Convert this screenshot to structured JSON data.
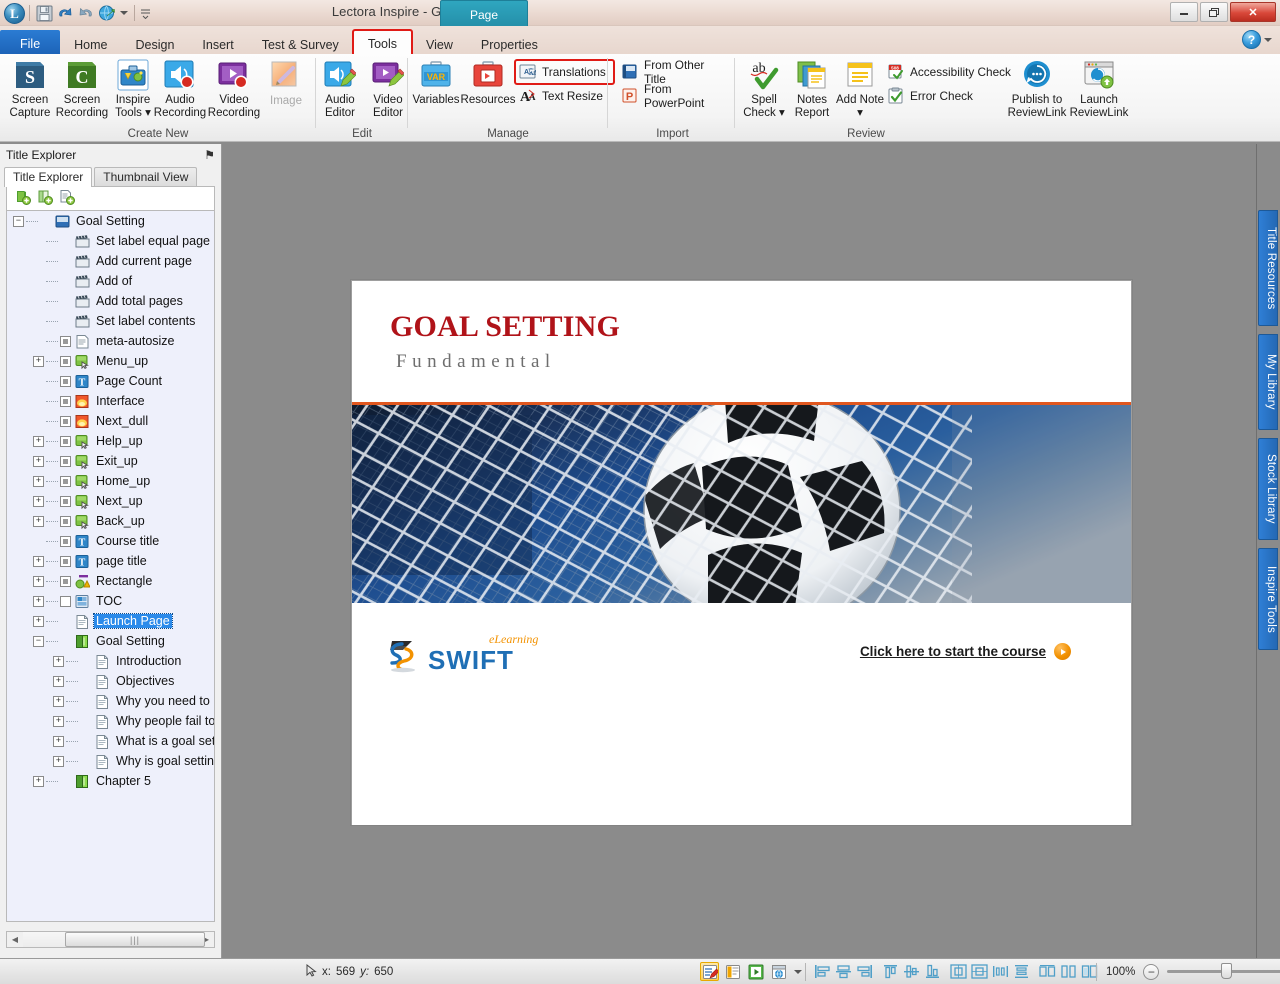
{
  "window": {
    "title": "Lectora Inspire - Goal Setting.awt",
    "minimize_label": "–",
    "restore_label": "❐",
    "close_label": "✕",
    "help_label": "?",
    "contextual_tab": "Page"
  },
  "quick_access": {
    "orb_label": "L",
    "items": [
      {
        "name": "save-icon",
        "label": "Save"
      },
      {
        "name": "undo-icon",
        "label": "Undo"
      },
      {
        "name": "redo-icon",
        "label": "Redo"
      },
      {
        "name": "preview-icon",
        "label": "Preview"
      },
      {
        "name": "customize-qat-icon",
        "label": "Customize Quick Access Toolbar"
      }
    ]
  },
  "ribbon": {
    "tabs": [
      {
        "label": "File",
        "active": false,
        "file": true
      },
      {
        "label": "Home",
        "active": false
      },
      {
        "label": "Design",
        "active": false
      },
      {
        "label": "Insert",
        "active": false
      },
      {
        "label": "Test & Survey",
        "active": false
      },
      {
        "label": "Tools",
        "active": true,
        "highlighted": true
      },
      {
        "label": "View",
        "active": false
      },
      {
        "label": "Properties",
        "active": false
      }
    ],
    "groups": {
      "create_new": {
        "label": "Create New",
        "buttons": [
          {
            "line1": "Screen",
            "line2": "Capture",
            "icon": "snagit-icon"
          },
          {
            "line1": "Screen",
            "line2": "Recording",
            "icon": "camtasia-icon"
          },
          {
            "line1": "Inspire",
            "line2": "Tools ▾",
            "icon": "inspire-tools-icon"
          },
          {
            "line1": "Audio",
            "line2": "Recording",
            "icon": "audio-record-icon"
          },
          {
            "line1": "Video",
            "line2": "Recording",
            "icon": "video-record-icon"
          },
          {
            "line1": "",
            "line2": "Image",
            "icon": "image-icon",
            "disabled": true
          }
        ]
      },
      "edit": {
        "label": "Edit",
        "buttons": [
          {
            "line1": "Audio",
            "line2": "Editor",
            "icon": "audio-editor-icon"
          },
          {
            "line1": "Video",
            "line2": "Editor",
            "icon": "video-editor-icon"
          }
        ]
      },
      "manage": {
        "label": "Manage",
        "buttons": [
          {
            "line1": "",
            "line2": "Variables",
            "icon": "variables-icon"
          },
          {
            "line1": "",
            "line2": "Resources",
            "icon": "resources-icon"
          }
        ],
        "small_buttons": [
          {
            "label": "Translations",
            "icon": "translations-icon",
            "highlighted": true
          },
          {
            "label": "Text Resize",
            "icon": "text-resize-icon",
            "highlighted": false
          }
        ]
      },
      "import": {
        "label": "Import",
        "small_buttons": [
          {
            "label": "From Other Title",
            "icon": "from-other-title-icon"
          },
          {
            "label": "From PowerPoint",
            "icon": "from-powerpoint-icon"
          }
        ]
      },
      "review": {
        "label": "Review",
        "buttons": [
          {
            "line1": "Spell",
            "line2": "Check ▾",
            "icon": "spell-check-icon"
          },
          {
            "line1": "Notes",
            "line2": "Report",
            "icon": "notes-report-icon"
          },
          {
            "line1": "Add Note",
            "line2": "▾",
            "icon": "add-note-icon"
          },
          {
            "line1": "Publish to",
            "line2": "ReviewLink",
            "icon": "publish-reviewlink-icon"
          },
          {
            "line1": "Launch",
            "line2": "ReviewLink",
            "icon": "launch-reviewlink-icon"
          }
        ],
        "small_buttons": [
          {
            "label": "Accessibility Check",
            "icon": "accessibility-check-icon"
          },
          {
            "label": "Error Check",
            "icon": "error-check-icon"
          }
        ]
      }
    }
  },
  "left_panel": {
    "header": "Title Explorer",
    "pin_glyph": "⚑",
    "tabs": [
      {
        "label": "Title Explorer",
        "active": true
      },
      {
        "label": "Thumbnail View",
        "active": false
      }
    ],
    "toolbar_icons": [
      {
        "name": "add-chapter-icon",
        "label": "Add Chapter"
      },
      {
        "name": "add-section-icon",
        "label": "Add Section"
      },
      {
        "name": "add-page-icon",
        "label": "Add Page"
      }
    ],
    "tree": [
      {
        "label": "Goal Setting",
        "indent": 0,
        "twist": "-",
        "check": "none",
        "icon": "title-book-icon"
      },
      {
        "label": "Set label equal page",
        "indent": 1,
        "twist": "",
        "check": "none",
        "icon": "action-icon"
      },
      {
        "label": "Add current page",
        "indent": 1,
        "twist": "",
        "check": "none",
        "icon": "action-icon"
      },
      {
        "label": "Add of",
        "indent": 1,
        "twist": "",
        "check": "none",
        "icon": "action-icon"
      },
      {
        "label": "Add total pages",
        "indent": 1,
        "twist": "",
        "check": "none",
        "icon": "action-icon"
      },
      {
        "label": "Set label contents",
        "indent": 1,
        "twist": "",
        "check": "none",
        "icon": "action-icon"
      },
      {
        "label": "meta-autosize",
        "indent": 1,
        "twist": "",
        "check": "filled",
        "icon": "text-block-icon"
      },
      {
        "label": "Menu_up",
        "indent": 1,
        "twist": "+",
        "check": "filled",
        "icon": "button-icon"
      },
      {
        "label": "Page Count",
        "indent": 1,
        "twist": "",
        "check": "filled",
        "icon": "text-icon"
      },
      {
        "label": "Interface",
        "indent": 1,
        "twist": "",
        "check": "filled",
        "icon": "image-thumb-icon"
      },
      {
        "label": "Next_dull",
        "indent": 1,
        "twist": "",
        "check": "filled",
        "icon": "image-thumb-icon"
      },
      {
        "label": "Help_up",
        "indent": 1,
        "twist": "+",
        "check": "filled",
        "icon": "button-icon"
      },
      {
        "label": "Exit_up",
        "indent": 1,
        "twist": "+",
        "check": "filled",
        "icon": "button-icon"
      },
      {
        "label": "Home_up",
        "indent": 1,
        "twist": "+",
        "check": "filled",
        "icon": "button-icon"
      },
      {
        "label": "Next_up",
        "indent": 1,
        "twist": "+",
        "check": "filled",
        "icon": "button-icon"
      },
      {
        "label": "Back_up",
        "indent": 1,
        "twist": "+",
        "check": "filled",
        "icon": "button-icon"
      },
      {
        "label": "Course title",
        "indent": 1,
        "twist": "",
        "check": "filled",
        "icon": "text-icon"
      },
      {
        "label": "page title",
        "indent": 1,
        "twist": "+",
        "check": "filled",
        "icon": "text-icon"
      },
      {
        "label": "Rectangle",
        "indent": 1,
        "twist": "+",
        "check": "filled",
        "icon": "shape-icon"
      },
      {
        "label": "TOC",
        "indent": 1,
        "twist": "+",
        "check": "empty",
        "icon": "toc-icon"
      },
      {
        "label": "Launch Page",
        "indent": 1,
        "twist": "+",
        "check": "none",
        "icon": "page-icon",
        "selected": true
      },
      {
        "label": "Goal Setting",
        "indent": 1,
        "twist": "-",
        "check": "none",
        "icon": "chapter-icon"
      },
      {
        "label": "Introduction",
        "indent": 2,
        "twist": "+",
        "check": "none",
        "icon": "page-icon"
      },
      {
        "label": "Objectives",
        "indent": 2,
        "twist": "+",
        "check": "none",
        "icon": "page-icon"
      },
      {
        "label": "Why you need to ha",
        "indent": 2,
        "twist": "+",
        "check": "none",
        "icon": "page-icon"
      },
      {
        "label": "Why people fail to a",
        "indent": 2,
        "twist": "+",
        "check": "none",
        "icon": "page-icon"
      },
      {
        "label": "What is a goal settin",
        "indent": 2,
        "twist": "+",
        "check": "none",
        "icon": "page-icon"
      },
      {
        "label": "Why is goal setting",
        "indent": 2,
        "twist": "+",
        "check": "none",
        "icon": "page-icon"
      },
      {
        "label": "Chapter 5",
        "indent": 1,
        "twist": "+",
        "check": "none",
        "icon": "chapter-icon"
      }
    ],
    "hscroll_grip": "|||"
  },
  "slide": {
    "title": "GOAL SETTING",
    "subtitle": "Fundamental",
    "title_color": "#b01319",
    "rule_color": "#e0571f",
    "logo_text": "SWIFT",
    "logo_superscript": "eLearning",
    "start_link": "Click here to start the course",
    "image_alt": "soccer-ball-in-net"
  },
  "right_tabs": [
    {
      "label": "Title Resources"
    },
    {
      "label": "My Library"
    },
    {
      "label": "Stock Library"
    },
    {
      "label": "Inspire Tools"
    }
  ],
  "status_bar": {
    "cursor_glyph": "⇖",
    "x_label": "x:",
    "x_value": "569",
    "y_label": "y:",
    "y_value": "650",
    "mode_icons": [
      {
        "name": "edit-mode-icon",
        "label": "Edit Mode",
        "selected": true
      },
      {
        "name": "run-mode-icon",
        "label": "Run Mode",
        "selected": false
      },
      {
        "name": "preview-mode-icon",
        "label": "Preview Mode",
        "selected": false
      },
      {
        "name": "preview-in-browser-icon",
        "label": "Preview in Browser",
        "selected": false
      }
    ],
    "align_icons": [
      {
        "name": "align-left-icon",
        "label": "Align Left"
      },
      {
        "name": "align-center-icon",
        "label": "Align Center"
      },
      {
        "name": "align-right-icon",
        "label": "Align Right"
      },
      {
        "name": "align-top-icon",
        "label": "Align Top"
      },
      {
        "name": "align-middle-icon",
        "label": "Align Middle"
      },
      {
        "name": "align-bottom-icon",
        "label": "Align Bottom"
      },
      {
        "name": "center-horizontally-icon",
        "label": "Center Horizontally"
      },
      {
        "name": "center-vertically-icon",
        "label": "Center Vertically"
      },
      {
        "name": "distribute-horizontally-icon",
        "label": "Distribute Horizontally"
      },
      {
        "name": "distribute-vertically-icon",
        "label": "Distribute Vertically"
      },
      {
        "name": "same-height-icon",
        "label": "Same Height"
      },
      {
        "name": "same-width-icon",
        "label": "Same Width"
      },
      {
        "name": "same-size-icon",
        "label": "Same Size"
      }
    ],
    "zoom_level": "100%",
    "zoom_out_label": "−",
    "zoom_in_label": "+"
  }
}
